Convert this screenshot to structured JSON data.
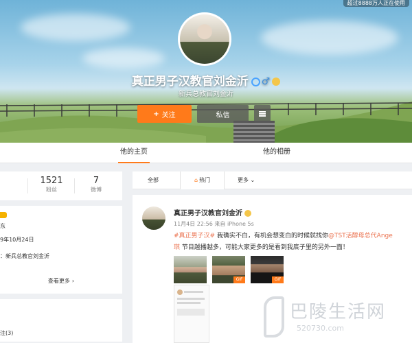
{
  "cover": {
    "top_badge": "超过8888万人正在使用"
  },
  "profile": {
    "name": "真正男子汉教官刘金沂",
    "intro": "新兵总教官刘金沂",
    "follow_label": "关注",
    "message_label": "私信"
  },
  "tabs": {
    "home": "他的主页",
    "album": "他的相册"
  },
  "stats": {
    "fans_count": "1521",
    "fans_label": "粉丝",
    "weibo_count": "7",
    "weibo_label": "微博"
  },
  "info": {
    "line1": "东",
    "line2": "9年10月24日",
    "line3": "：新兵总教官刘金沂",
    "view_more": "查看更多",
    "bottom_label": "注(3)"
  },
  "feed_tabs": {
    "all": "全部",
    "hot": "热门",
    "more": "更多"
  },
  "post": {
    "author": "真正男子汉教官刘金沂",
    "meta": "11月4日 22:56 来自 iPhone 5s",
    "hashtag": "#真正男子汉#",
    "text_a": " 我确实不白，有机会想变白的时候就找你",
    "mention": "@TST活醇母总代Ange",
    "text_b": "琪",
    "text_c": " 节目越播越多，可能大家更多的是看到我底子里的另外一面！",
    "gif_label": "GIF"
  },
  "watermark": {
    "text": "巴陵生活网",
    "url": "520730.com"
  }
}
